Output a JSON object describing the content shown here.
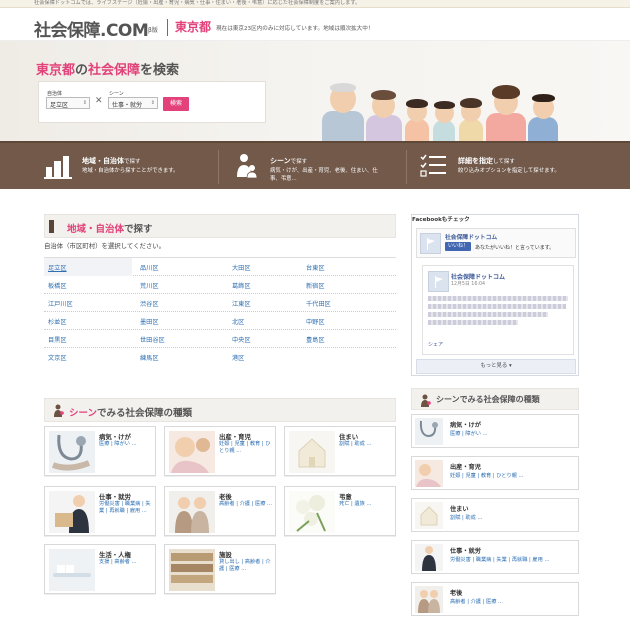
{
  "topbar": {
    "text": "社会保障ドットコムでは、ライフステージ（妊娠・出産・育児・病気・仕事・住まい・老後・弔意）に応じた社会保障制度をご案内します。"
  },
  "header": {
    "logo": "社会保障.COM",
    "beta": "β版",
    "prefecture": "東京都",
    "notice": "現在は東京23区内のみに対応しています。地域は順次拡大中！"
  },
  "hero": {
    "title_pref": "東京都",
    "title_mid": "の",
    "title_kw": "社会保障",
    "title_end": "を検索",
    "search": {
      "municipality_label": "自治体",
      "municipality_value": "足立区",
      "scene_label": "シーン",
      "scene_value": "仕事・就労",
      "button": "検索"
    }
  },
  "features": [
    {
      "title": "地域・自治体",
      "title_suffix": "で探す",
      "desc": "地域・自治体から探すことができます。",
      "icon": "buildings-icon"
    },
    {
      "title": "シーン",
      "title_suffix": "で探す",
      "desc": "病気・けが、出産・育児、老後、住まい、仕事、弔意...",
      "icon": "family-icon"
    },
    {
      "title": "詳細を指定",
      "title_suffix": "して探す",
      "desc": "絞り込みオプションを指定して探せます。",
      "icon": "checklist-icon"
    }
  ],
  "area_section": {
    "heading_kw": "地域・自治体",
    "heading_end": "で探す",
    "intro": "自治体（市区町村）を選択してください。",
    "rows": [
      [
        "足立区",
        "品川区",
        "大田区",
        "台東区"
      ],
      [
        "板橋区",
        "荒川区",
        "葛飾区",
        "新宿区"
      ],
      [
        "江戸川区",
        "渋谷区",
        "江東区",
        "千代田区"
      ],
      [
        "杉並区",
        "墨田区",
        "北区",
        "中野区"
      ],
      [
        "目黒区",
        "世田谷区",
        "中央区",
        "豊島区"
      ],
      [
        "文京区",
        "練馬区",
        "港区",
        ""
      ]
    ]
  },
  "scene_section": {
    "heading_kw": "シーン",
    "heading_end": "でみる社会保障の種類",
    "cards": [
      {
        "title": "病気・けが",
        "tags": "医療 | 障がい ..."
      },
      {
        "title": "出産・育児",
        "tags": "妊娠 | 児童 | 教育 | ひとり親 ..."
      },
      {
        "title": "住まい",
        "tags": "割賦 | 助成 ..."
      },
      {
        "title": "仕事・就労",
        "tags": "労働災害 | 職業病 | 失業 | 再就職 | 雇用 ..."
      },
      {
        "title": "老後",
        "tags": "高齢者 | 介護 | 医療 ..."
      },
      {
        "title": "弔意",
        "tags": "死亡 | 遺族 ..."
      },
      {
        "title": "生活・人権",
        "tags": "支援 | 高齢者 ..."
      },
      {
        "title": "施設",
        "tags": "貸し出し | 高齢者 | 介護 | 医療 ..."
      }
    ]
  },
  "facebook": {
    "heading": "Facebookもチェック",
    "page_name": "社会保障ドットコム",
    "like_button": "いいね！",
    "like_text": "あなたがいいね！と言っています。",
    "post_name": "社会保障ドットコム",
    "post_date": "12月5日 16:04",
    "share": "シェア",
    "more": "もっと見る ▾"
  },
  "side_scene": {
    "heading": "シーンでみる社会保障の種類",
    "cards": [
      {
        "title": "病気・けが",
        "tags": "医療 | 障がい ..."
      },
      {
        "title": "出産・育児",
        "tags": "妊娠 | 児童 | 教育 | ひとり親 ..."
      },
      {
        "title": "住まい",
        "tags": "割賦 | 助成 ..."
      },
      {
        "title": "仕事・就労",
        "tags": "労働災害 | 職業病 | 失業 | 再就職 | 雇用 ..."
      },
      {
        "title": "老後",
        "tags": "高齢者 | 介護 | 医療 ..."
      }
    ]
  },
  "colors": {
    "accent": "#e2417a",
    "brown": "#72594a",
    "link": "#2d6fb3"
  }
}
